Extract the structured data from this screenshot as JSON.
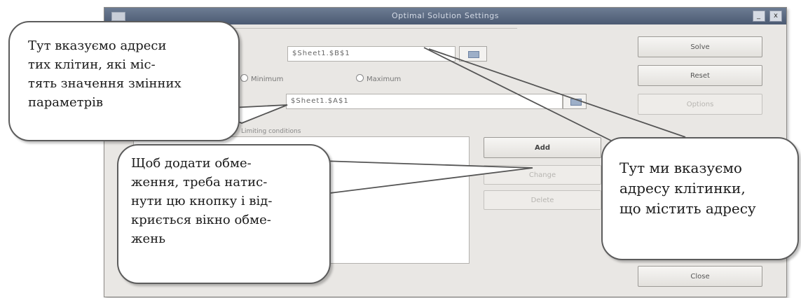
{
  "window": {
    "title": "Optimal Solution Settings",
    "minimize_glyph": "_",
    "close_glyph": "x"
  },
  "form": {
    "target_cell_value": "$Sheet1.$B$1",
    "variable_cells_value": "$Sheet1.$A$1",
    "option_min": "Minimum",
    "option_max": "Maximum",
    "limiting_label": "Limiting conditions"
  },
  "buttons": {
    "solve": "Solve",
    "reset": "Reset",
    "options": "Options",
    "add": "Add",
    "change": "Change",
    "delete": "Delete",
    "close": "Close"
  },
  "callouts": {
    "top_left": [
      "Тут вказуємо адреси",
      "тих клітин, які міс-",
      "тять значення змінних",
      "параметрів"
    ],
    "bottom_left": [
      "Щоб додати обме-",
      "ження, треба натис-",
      "нути цю кнопку і від-",
      "криється вікно обме-",
      "жень"
    ],
    "right": [
      "Тут ми вказуємо",
      "адресу клітинки,",
      "що містить адресу"
    ]
  },
  "icons": {
    "picker": "cell-range-picker-icon",
    "window": "window-app-icon"
  }
}
